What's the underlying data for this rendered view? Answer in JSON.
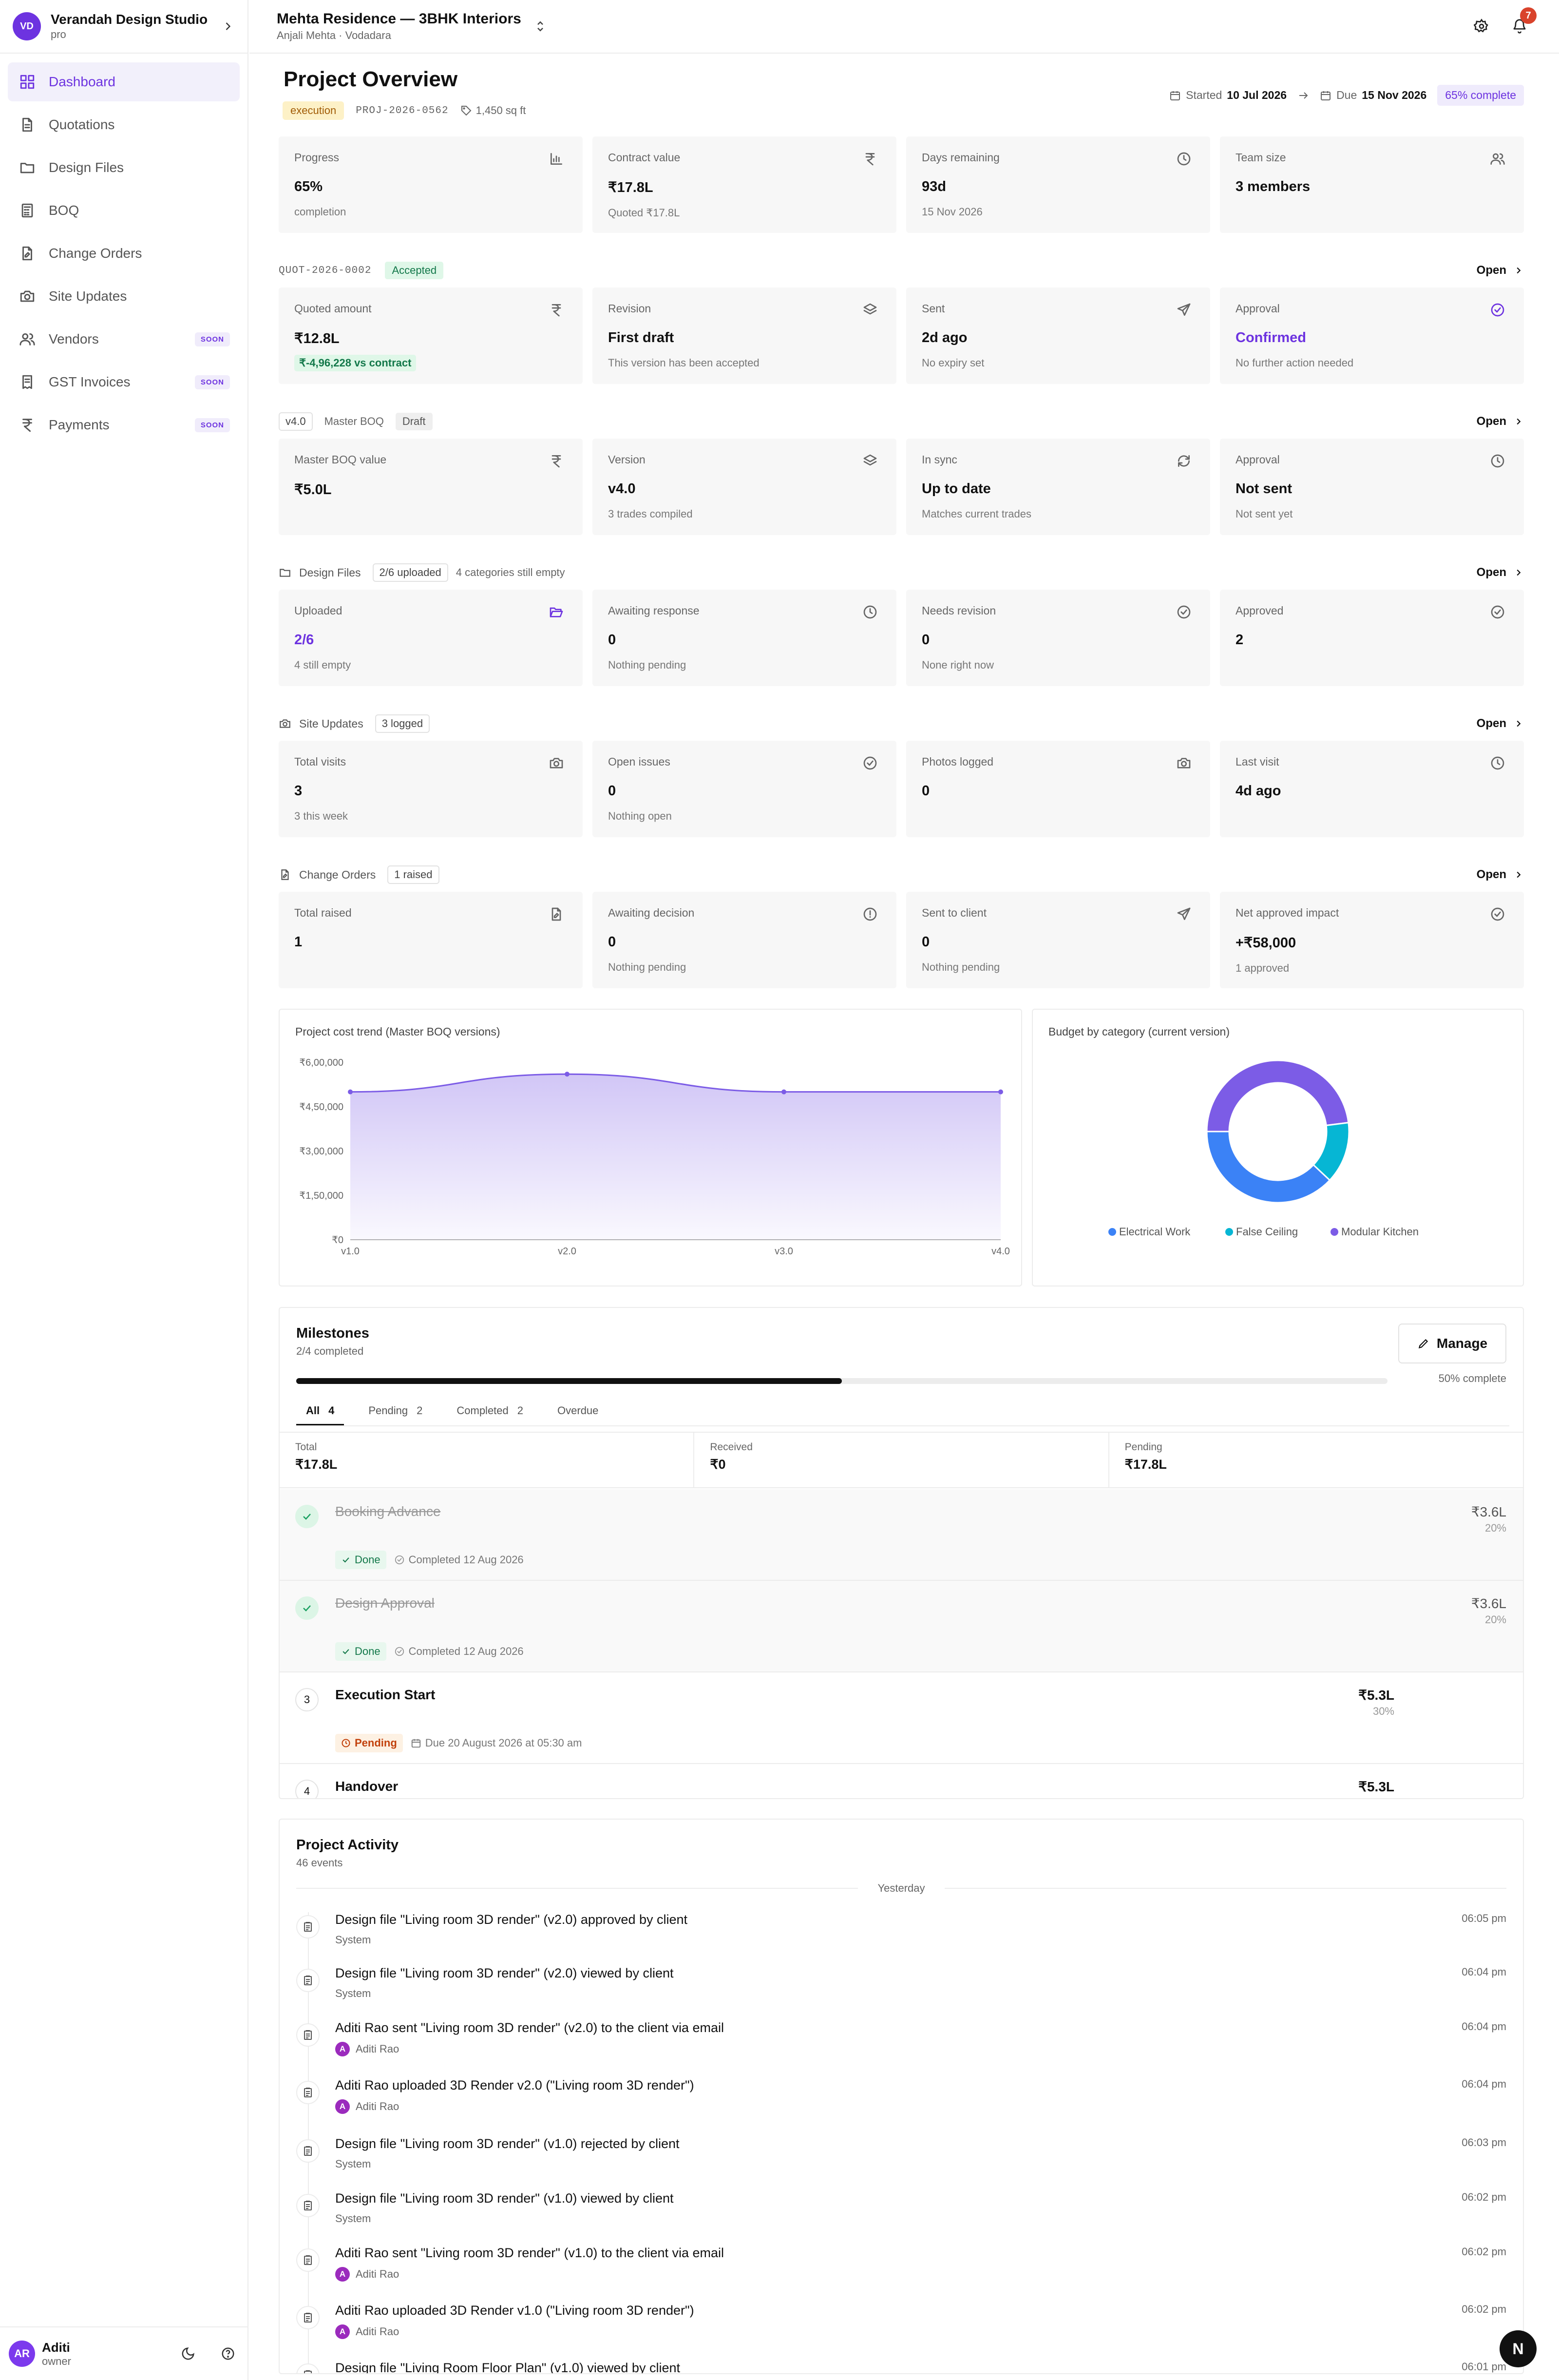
{
  "workspace": {
    "initials": "VD",
    "name": "Verandah Design Studio",
    "plan": "pro"
  },
  "nav": [
    {
      "label": "Dashboard",
      "icon": "dashboard-icon",
      "active": true,
      "soon": ""
    },
    {
      "label": "Quotations",
      "icon": "document-icon",
      "soon": ""
    },
    {
      "label": "Design Files",
      "icon": "folder-icon",
      "soon": ""
    },
    {
      "label": "BOQ",
      "icon": "calculator-icon",
      "soon": ""
    },
    {
      "label": "Change Orders",
      "icon": "file-edit-icon",
      "soon": ""
    },
    {
      "label": "Site Updates",
      "icon": "camera-icon",
      "soon": ""
    },
    {
      "label": "Vendors",
      "icon": "users-icon",
      "soon": "SOON"
    },
    {
      "label": "GST Invoices",
      "icon": "receipt-icon",
      "soon": "SOON"
    },
    {
      "label": "Payments",
      "icon": "rupee-icon",
      "soon": "SOON"
    }
  ],
  "user": {
    "initials": "AR",
    "name": "Aditi",
    "role": "owner"
  },
  "topbar": {
    "project": "Mehta Residence — 3BHK Interiors",
    "client": "Anjali Mehta · Vodadara",
    "notifications": "7"
  },
  "overview": {
    "title": "Project Overview",
    "stage": "execution",
    "code": "PROJ-2026-0562",
    "area": "1,450 sq ft",
    "started_label": "Started",
    "started": "10 Jul 2026",
    "due_label": "Due",
    "due": "15 Nov 2026",
    "percent": "65% complete"
  },
  "kpis": [
    {
      "label": "Progress",
      "value": "65%",
      "sub": "completion",
      "icon": "bar-chart-icon"
    },
    {
      "label": "Contract value",
      "value": "₹17.8L",
      "sub": "Quoted ₹17.8L",
      "icon": "rupee-icon"
    },
    {
      "label": "Days remaining",
      "value": "93d",
      "sub": "15 Nov 2026",
      "icon": "clock-icon"
    },
    {
      "label": "Team size",
      "value": "3 members",
      "sub": "",
      "icon": "users-icon"
    }
  ],
  "quotation": {
    "code": "QUOT-2026-0002",
    "status": "Accepted",
    "open": "Open",
    "cards": [
      {
        "label": "Quoted amount",
        "value": "₹12.8L",
        "sub": "",
        "icon": "rupee-icon"
      },
      {
        "label": "Revision",
        "value": "First draft",
        "sub": "This version has been accepted",
        "icon": "layers-icon"
      },
      {
        "label": "Sent",
        "value": "2d ago",
        "sub": "No expiry set",
        "icon": "send-icon"
      },
      {
        "label": "Approval",
        "value": "Confirmed",
        "sub": "No further action needed",
        "icon": "check-circle-icon"
      }
    ],
    "diff": "₹-4,96,228 vs contract"
  },
  "boq": {
    "version_chip": "v4.0",
    "title": "Master BOQ",
    "status": "Draft",
    "open": "Open",
    "cards": [
      {
        "label": "Master BOQ value",
        "value": "₹5.0L",
        "sub": "",
        "icon": "rupee-icon"
      },
      {
        "label": "Version",
        "value": "v4.0",
        "sub": "3 trades compiled",
        "icon": "layers-icon"
      },
      {
        "label": "In sync",
        "value": "Up to date",
        "sub": "Matches current trades",
        "icon": "refresh-icon"
      },
      {
        "label": "Approval",
        "value": "Not sent",
        "sub": "Not sent yet",
        "icon": "clock-icon"
      }
    ]
  },
  "design_files": {
    "title": "Design Files",
    "chip": "2/6 uploaded",
    "note": "4 categories still empty",
    "open": "Open",
    "cards": [
      {
        "label": "Uploaded",
        "value": "2/6",
        "sub": "4 still empty",
        "icon": "folder-open-icon"
      },
      {
        "label": "Awaiting response",
        "value": "0",
        "sub": "Nothing pending",
        "icon": "clock-icon"
      },
      {
        "label": "Needs revision",
        "value": "0",
        "sub": "None right now",
        "icon": "check-circle-icon"
      },
      {
        "label": "Approved",
        "value": "2",
        "sub": "",
        "icon": "check-circle-icon"
      }
    ]
  },
  "site_updates": {
    "title": "Site Updates",
    "chip": "3 logged",
    "open": "Open",
    "cards": [
      {
        "label": "Total visits",
        "value": "3",
        "sub": "3 this week",
        "icon": "camera-icon"
      },
      {
        "label": "Open issues",
        "value": "0",
        "sub": "Nothing open",
        "icon": "check-circle-icon"
      },
      {
        "label": "Photos logged",
        "value": "0",
        "sub": "",
        "icon": "camera-icon"
      },
      {
        "label": "Last visit",
        "value": "4d ago",
        "sub": "",
        "icon": "clock-icon"
      }
    ]
  },
  "change_orders": {
    "title": "Change Orders",
    "chip": "1 raised",
    "open": "Open",
    "cards": [
      {
        "label": "Total raised",
        "value": "1",
        "sub": "",
        "icon": "file-edit-icon"
      },
      {
        "label": "Awaiting decision",
        "value": "0",
        "sub": "Nothing pending",
        "icon": "alert-circle-icon"
      },
      {
        "label": "Sent to client",
        "value": "0",
        "sub": "Nothing pending",
        "icon": "send-icon"
      },
      {
        "label": "Net approved impact",
        "value": "+₹58,000",
        "sub": "1 approved",
        "icon": "check-circle-icon"
      }
    ]
  },
  "chart_data": [
    {
      "type": "area",
      "title": "Project cost trend (Master BOQ versions)",
      "categories": [
        "v1.0",
        "v2.0",
        "v3.0",
        "v4.0"
      ],
      "values": [
        500000,
        560000,
        500000,
        500000
      ],
      "yticks": [
        "₹0",
        "₹1,50,000",
        "₹3,00,000",
        "₹4,50,000",
        "₹6,00,000"
      ],
      "ylim": [
        0,
        600000
      ],
      "color": "#7c5ce6"
    },
    {
      "type": "pie",
      "title": "Budget by category (current version)",
      "labels": [
        "Electrical Work",
        "False Ceiling",
        "Modular Kitchen"
      ],
      "values": [
        38,
        14,
        48
      ],
      "colors": [
        "#3b82f6",
        "#06b6d4",
        "#7c5ce6"
      ],
      "legend": "bottom"
    }
  ],
  "milestones": {
    "title": "Milestones",
    "subtitle": "2/4 completed",
    "manage": "Manage",
    "progress": 0.5,
    "progress_label": "50% complete",
    "tabs": [
      {
        "label": "All",
        "count": "4",
        "active": true
      },
      {
        "label": "Pending",
        "count": "2"
      },
      {
        "label": "Completed",
        "count": "2"
      },
      {
        "label": "Overdue",
        "count": ""
      }
    ],
    "stats": [
      {
        "label": "Total",
        "value": "₹17.8L"
      },
      {
        "label": "Received",
        "value": "₹0"
      },
      {
        "label": "Pending",
        "value": "₹17.8L"
      }
    ],
    "items": [
      {
        "n": "",
        "title": "Booking Advance",
        "amount": "₹3.6L",
        "pct": "20%",
        "done": true,
        "status": "Done",
        "meta": "Completed 12 Aug 2026"
      },
      {
        "n": "",
        "title": "Design Approval",
        "amount": "₹3.6L",
        "pct": "20%",
        "done": true,
        "status": "Done",
        "meta": "Completed 12 Aug 2026"
      },
      {
        "n": "3",
        "title": "Execution Start",
        "amount": "₹5.3L",
        "pct": "30%",
        "done": false,
        "status": "Pending",
        "meta": "Due 20 August 2026 at 05:30 am"
      },
      {
        "n": "4",
        "title": "Handover",
        "amount": "₹5.3L",
        "pct": "",
        "done": false,
        "status": "",
        "meta": ""
      }
    ]
  },
  "activity": {
    "title": "Project Activity",
    "subtitle": "46 events",
    "day": "Yesterday",
    "events": [
      {
        "text": "Design file \"Living room 3D render\" (v2.0) approved by client",
        "by": "System",
        "avatar": "",
        "time": "06:05 pm"
      },
      {
        "text": "Design file \"Living room 3D render\" (v2.0) viewed by client",
        "by": "System",
        "avatar": "",
        "time": "06:04 pm"
      },
      {
        "text": "Aditi Rao sent \"Living room 3D render\" (v2.0) to the client via email",
        "by": "Aditi Rao",
        "avatar": "A",
        "time": "06:04 pm"
      },
      {
        "text": "Aditi Rao uploaded 3D Render v2.0 (\"Living room 3D render\")",
        "by": "Aditi Rao",
        "avatar": "A",
        "time": "06:04 pm"
      },
      {
        "text": "Design file \"Living room 3D render\" (v1.0) rejected by client",
        "by": "System",
        "avatar": "",
        "time": "06:03 pm"
      },
      {
        "text": "Design file \"Living room 3D render\" (v1.0) viewed by client",
        "by": "System",
        "avatar": "",
        "time": "06:02 pm"
      },
      {
        "text": "Aditi Rao sent \"Living room 3D render\" (v1.0) to the client via email",
        "by": "Aditi Rao",
        "avatar": "A",
        "time": "06:02 pm"
      },
      {
        "text": "Aditi Rao uploaded 3D Render v1.0 (\"Living room 3D render\")",
        "by": "Aditi Rao",
        "avatar": "A",
        "time": "06:02 pm"
      },
      {
        "text": "Design file \"Living Room Floor Plan\" (v1.0) viewed by client",
        "by": "",
        "avatar": "",
        "time": "06:01 pm"
      }
    ]
  },
  "fab": "N"
}
